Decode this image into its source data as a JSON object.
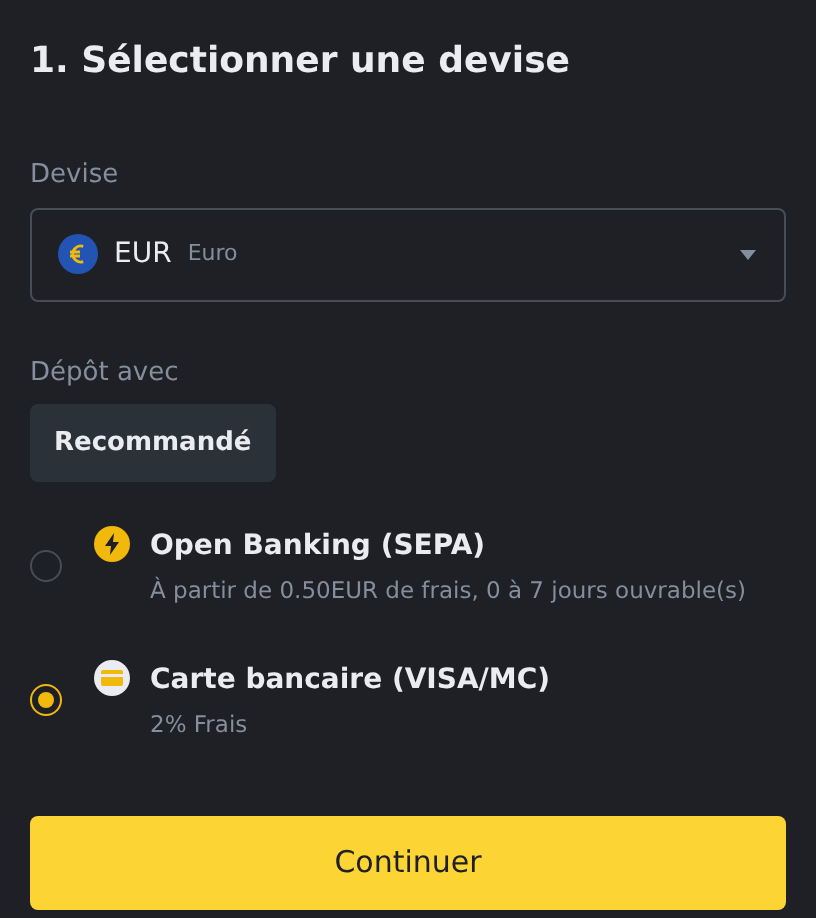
{
  "title": "1. Sélectionner une devise",
  "currency": {
    "label": "Devise",
    "code": "EUR",
    "name": "Euro"
  },
  "deposit": {
    "label": "Dépôt avec",
    "tabs": [
      {
        "label": "Recommandé",
        "selected": true
      }
    ],
    "methods": [
      {
        "kind": "lightning",
        "name": "Open Banking (SEPA)",
        "detail": "À partir de 0.50EUR de frais, 0 à 7 jours ouvrable(s)",
        "selected": false
      },
      {
        "kind": "card",
        "name": "Carte bancaire (VISA/MC)",
        "detail": "2% Frais",
        "selected": true
      }
    ]
  },
  "button": "Continuer"
}
